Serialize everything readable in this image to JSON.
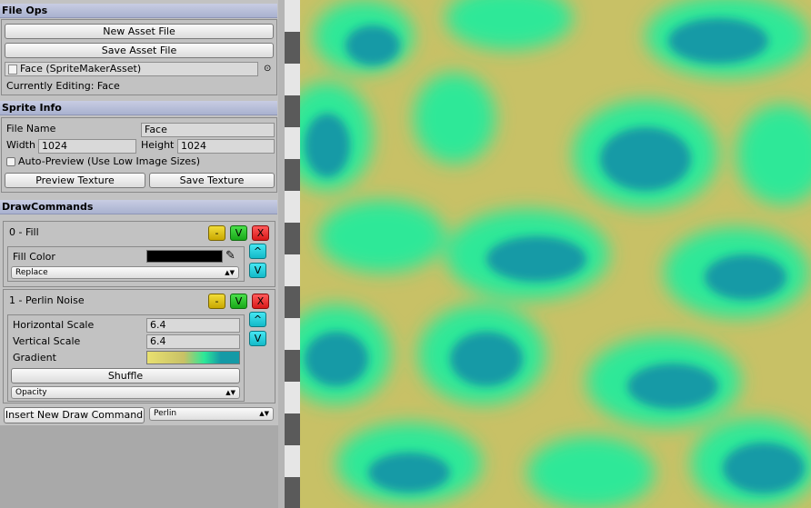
{
  "file_ops": {
    "header": "File Ops",
    "new_asset_label": "New Asset File",
    "save_asset_label": "Save Asset File",
    "asset_field_value": "Face (SpriteMakerAsset)",
    "currently_editing": "Currently Editing: Face"
  },
  "sprite_info": {
    "header": "Sprite Info",
    "file_name_label": "File Name",
    "file_name_value": "Face",
    "width_label": "Width",
    "width_value": "1024",
    "height_label": "Height",
    "height_value": "1024",
    "auto_preview_label": "Auto-Preview (Use Low Image Sizes)",
    "auto_preview_checked": false,
    "preview_label": "Preview Texture",
    "save_texture_label": "Save Texture"
  },
  "draw_commands": {
    "header": "DrawCommands",
    "buttons": {
      "minus": "-",
      "v": "V",
      "x": "X",
      "up": "^",
      "down": "V"
    },
    "commands": [
      {
        "title": "0 - Fill",
        "fill_color_label": "Fill Color",
        "fill_color_value": "#000000",
        "blend_mode": "Replace"
      },
      {
        "title": "1 - Perlin Noise",
        "h_scale_label": "Horizontal Scale",
        "h_scale_value": "6.4",
        "v_scale_label": "Vertical Scale",
        "v_scale_value": "6.4",
        "gradient_label": "Gradient",
        "gradient_colors": [
          "#e8e070",
          "#c8c166",
          "#2de898",
          "#159aa6"
        ],
        "shuffle_label": "Shuffle",
        "blend_mode": "Opacity"
      }
    ],
    "insert_label": "Insert New Draw Command",
    "insert_type": "Perlin"
  },
  "colors": {
    "header_bg": "#b0b8d4",
    "panel_bg": "#c2c2c2",
    "noise_sand": "#c8c166",
    "noise_mint": "#2de898",
    "noise_teal": "#159aa6"
  }
}
